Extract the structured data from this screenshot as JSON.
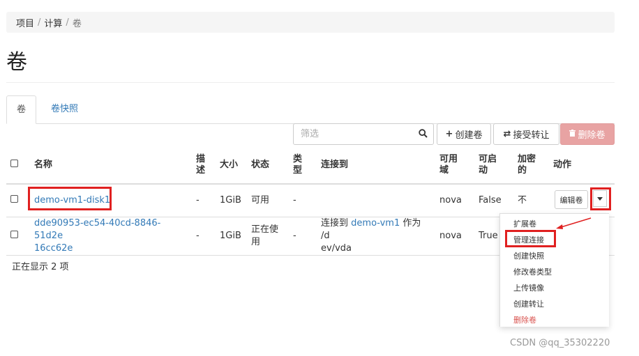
{
  "breadcrumb": {
    "items": [
      "项目",
      "计算",
      "卷"
    ],
    "separator": "/"
  },
  "page_title": "卷",
  "tabs": [
    {
      "label": "卷",
      "active": true
    },
    {
      "label": "卷快照",
      "active": false
    }
  ],
  "toolbar": {
    "filter_placeholder": "筛选",
    "create_label": "创建卷",
    "accept_label": "接受转让",
    "delete_label": "删除卷"
  },
  "table": {
    "headers": {
      "name": "名称",
      "desc_1": "描",
      "desc_2": "述",
      "size": "大小",
      "status": "状态",
      "type_1": "类",
      "type_2": "型",
      "attached": "连接到",
      "az_1": "可用",
      "az_2": "域",
      "boot_1": "可启",
      "boot_2": "动",
      "enc_1": "加密",
      "enc_2": "的",
      "actions": "动作"
    },
    "rows": [
      {
        "name": "demo-vm1-disk1",
        "desc": "-",
        "size": "1GiB",
        "status": "可用",
        "type": "-",
        "az": "nova",
        "bootable": "False",
        "encrypted": "不",
        "action": "编辑卷"
      },
      {
        "name_1": "dde90953-ec54-40cd-8846-51d2e",
        "name_2": "16cc62e",
        "desc": "-",
        "size": "1GiB",
        "status_1": "正在使",
        "status_2": "用",
        "type": "-",
        "attach_prefix": "连接到",
        "attach_link": "demo-vm1",
        "attach_mid": "作为 /d",
        "attach_tail": "ev/vda",
        "az": "nova",
        "bootable": "True"
      }
    ]
  },
  "action_menu": {
    "items": [
      "扩展卷",
      "管理连接",
      "创建快照",
      "修改卷类型",
      "上传镜像",
      "创建转让",
      "删除卷"
    ]
  },
  "footer": {
    "count_text": "正在显示 2 项"
  },
  "watermark": "CSDN @qq_35302220",
  "colors": {
    "link": "#337ab7",
    "highlight": "#e02020",
    "danger": "#d9534f",
    "delete_button": "#e8a3a3"
  }
}
